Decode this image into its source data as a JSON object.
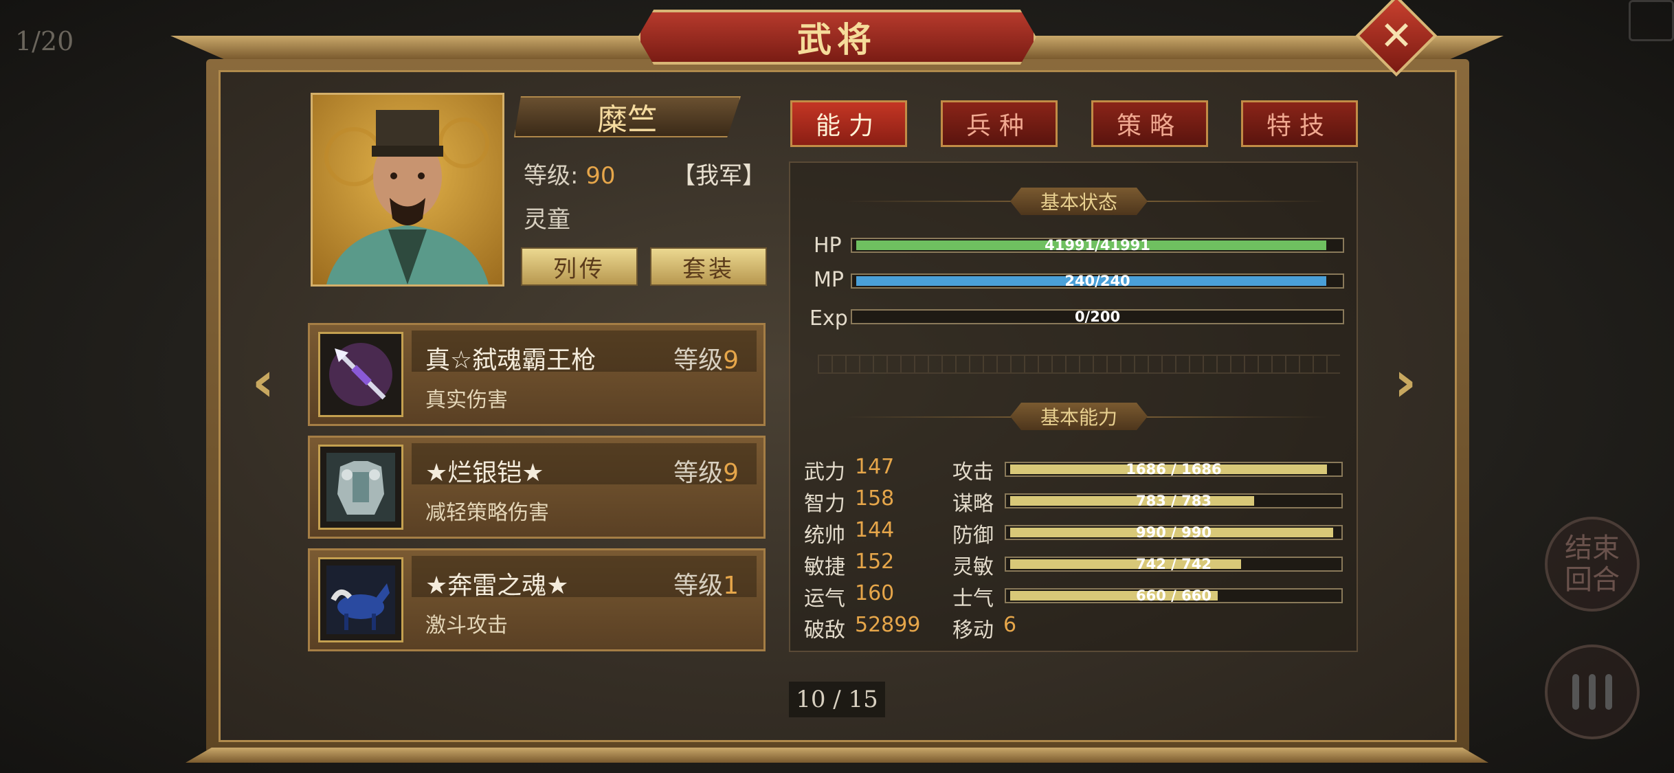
{
  "hud": {
    "turn_counter": "1/20",
    "end_turn": "结束回合"
  },
  "window": {
    "title": "武将",
    "close": "✕"
  },
  "general": {
    "name": "糜竺",
    "level_label": "等级:",
    "level": "90",
    "faction": "【我军】",
    "job": "灵童",
    "buttons": [
      "列传",
      "套装"
    ]
  },
  "equipment": [
    {
      "name": "真☆弑魂霸王枪",
      "level_label": "等级",
      "level": "9",
      "desc": "真实伤害",
      "icon": "spear-icon"
    },
    {
      "name": "★烂银铠★",
      "level_label": "等级",
      "level": "9",
      "desc": "减轻策略伤害",
      "icon": "armor-icon"
    },
    {
      "name": "★奔雷之魂★",
      "level_label": "等级",
      "level": "1",
      "desc": "激斗攻击",
      "icon": "horse-icon"
    }
  ],
  "tabs": [
    "能力",
    "兵种",
    "策略",
    "特技"
  ],
  "status": {
    "title": "基本状态",
    "hp": {
      "label": "HP",
      "text": "41991/41991",
      "value": 41991,
      "max": 41991,
      "color": "#6fc060"
    },
    "mp": {
      "label": "MP",
      "text": "240/240",
      "value": 240,
      "max": 240,
      "color": "#4aa0d8"
    },
    "exp": {
      "label": "Exp",
      "text": "0/200",
      "value": 0,
      "max": 200,
      "color": "#c8b060"
    }
  },
  "ability": {
    "title": "基本能力",
    "left": [
      {
        "label": "武力",
        "value": "147"
      },
      {
        "label": "智力",
        "value": "158"
      },
      {
        "label": "统帅",
        "value": "144"
      },
      {
        "label": "敏捷",
        "value": "152"
      },
      {
        "label": "运气",
        "value": "160"
      },
      {
        "label": "破敌",
        "value": "52899"
      }
    ],
    "right": [
      {
        "label": "攻击",
        "text": "1686 / 1686",
        "fill": 0.96
      },
      {
        "label": "谋略",
        "text": "783 / 783",
        "fill": 0.74
      },
      {
        "label": "防御",
        "text": "990 / 990",
        "fill": 0.98
      },
      {
        "label": "灵敏",
        "text": "742 / 742",
        "fill": 0.7
      },
      {
        "label": "士气",
        "text": "660 / 660",
        "fill": 0.63
      }
    ],
    "move": {
      "label": "移动",
      "value": "6"
    }
  },
  "pager": "10 / 15",
  "colors": {
    "bar_gold": "#d8c878",
    "accent": "#e6a64a"
  }
}
